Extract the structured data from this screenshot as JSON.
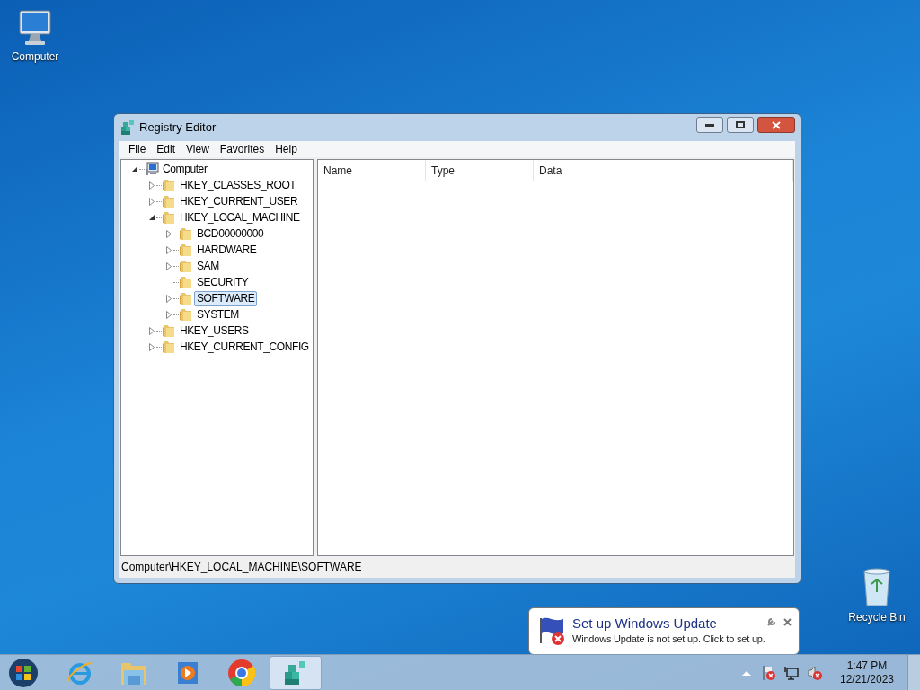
{
  "desktop_icons": [
    {
      "label": "Computer"
    },
    {
      "label": "Recycle Bin"
    }
  ],
  "window": {
    "title": "Registry Editor"
  },
  "menu": [
    "File",
    "Edit",
    "View",
    "Favorites",
    "Help"
  ],
  "tree": [
    {
      "label": "Computer",
      "expanded": true,
      "selected": false,
      "children": [
        {
          "label": "HKEY_CLASSES_ROOT",
          "expanded": false,
          "selected": false
        },
        {
          "label": "HKEY_CURRENT_USER",
          "expanded": false,
          "selected": false
        },
        {
          "label": "HKEY_LOCAL_MACHINE",
          "expanded": true,
          "selected": false,
          "children": [
            {
              "label": "BCD00000000",
              "expanded": false,
              "selected": false
            },
            {
              "label": "HARDWARE",
              "expanded": false,
              "selected": false
            },
            {
              "label": "SAM",
              "expanded": false,
              "selected": false
            },
            {
              "label": "SECURITY",
              "selected": false
            },
            {
              "label": "SOFTWARE",
              "expanded": false,
              "selected": true
            },
            {
              "label": "SYSTEM",
              "expanded": false,
              "selected": false
            }
          ]
        },
        {
          "label": "HKEY_USERS",
          "expanded": false,
          "selected": false
        },
        {
          "label": "HKEY_CURRENT_CONFIG",
          "expanded": false,
          "selected": false
        }
      ]
    }
  ],
  "columns": [
    "Name",
    "Type",
    "Data"
  ],
  "status_bar": "Computer\\HKEY_LOCAL_MACHINE\\SOFTWARE",
  "notification": {
    "title": "Set up Windows Update",
    "message": "Windows Update is not set up. Click to set up."
  },
  "taskbar_buttons": [
    {
      "selected": false
    },
    {
      "selected": false
    },
    {
      "selected": false
    },
    {
      "selected": false
    },
    {
      "selected": true
    }
  ],
  "clock": {
    "time": "1:47 PM",
    "date": "12/21/2023"
  }
}
